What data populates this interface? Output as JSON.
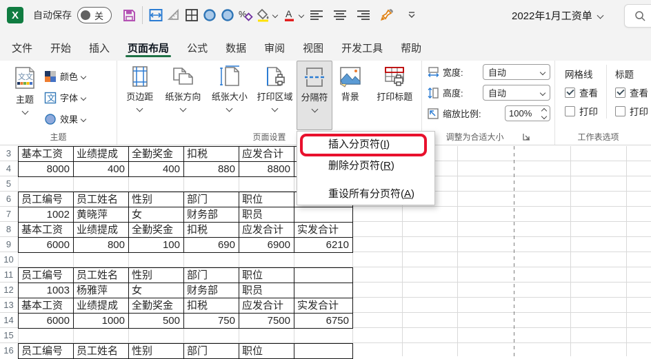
{
  "titlebar": {
    "autosave_label": "自动保存",
    "autosave_state": "关",
    "doc_title": "2022年1月工资单"
  },
  "tabs": {
    "items": [
      "文件",
      "开始",
      "插入",
      "页面布局",
      "公式",
      "数据",
      "审阅",
      "视图",
      "开发工具",
      "帮助"
    ],
    "active_index": 3
  },
  "ribbon": {
    "theme_group": {
      "label": "主题",
      "big_button": "主题",
      "items": [
        "颜色",
        "字体",
        "效果"
      ]
    },
    "page_setup_group": {
      "label": "页面设置",
      "buttons": [
        "页边距",
        "纸张方向",
        "纸张大小",
        "打印区域",
        "分隔符",
        "背景",
        "打印标题"
      ],
      "pressed_button": "分隔符"
    },
    "fit_group": {
      "label": "调整为合适大小",
      "width_label": "宽度:",
      "width_value": "自动",
      "height_label": "高度:",
      "height_value": "自动",
      "scale_label": "缩放比例:",
      "scale_value": "100%"
    },
    "sheet_options_group": {
      "label": "工作表选项",
      "columns": [
        {
          "title": "网格线",
          "view": {
            "label": "查看",
            "checked": true
          },
          "print": {
            "label": "打印",
            "checked": false
          }
        },
        {
          "title": "标题",
          "view": {
            "label": "查看",
            "checked": true
          },
          "print": {
            "label": "打印",
            "checked": false
          }
        }
      ]
    }
  },
  "menu": {
    "items": [
      {
        "pre": "插入分页符(",
        "key": "I",
        "suf": ")",
        "annotated": true
      },
      {
        "pre": "删除分页符(",
        "key": "R",
        "suf": ")"
      },
      {
        "sep": true
      },
      {
        "pre": "重设所有分页符(",
        "key": "A",
        "suf": ")"
      }
    ]
  },
  "annotation": {
    "color": "#e8112d",
    "target": "插入分页符(I)"
  },
  "accent_green": "#1e7145",
  "sheet": {
    "rows": [
      {
        "num": "3",
        "cells": [
          "基本工资",
          "业绩提成",
          "全勤奖金",
          "扣税",
          "应发合计",
          ""
        ]
      },
      {
        "num": "4",
        "cells": [
          "8000",
          "400",
          "400",
          "880",
          "8800",
          ""
        ]
      },
      {
        "num": "5",
        "cells": null
      },
      {
        "num": "6",
        "cells": [
          "员工编号",
          "员工姓名",
          "性别",
          "部门",
          "职位",
          ""
        ]
      },
      {
        "num": "7",
        "cells": [
          "1002",
          "黄晓萍",
          "女",
          "财务部",
          "职员",
          ""
        ]
      },
      {
        "num": "8",
        "cells": [
          "基本工资",
          "业绩提成",
          "全勤奖金",
          "扣税",
          "应发合计",
          "实发合计"
        ]
      },
      {
        "num": "9",
        "cells": [
          "6000",
          "800",
          "100",
          "690",
          "6900",
          "6210"
        ]
      },
      {
        "num": "10",
        "cells": null
      },
      {
        "num": "11",
        "cells": [
          "员工编号",
          "员工姓名",
          "性别",
          "部门",
          "职位",
          ""
        ]
      },
      {
        "num": "12",
        "cells": [
          "1003",
          "杨雅萍",
          "女",
          "财务部",
          "职员",
          ""
        ]
      },
      {
        "num": "13",
        "cells": [
          "基本工资",
          "业绩提成",
          "全勤奖金",
          "扣税",
          "应发合计",
          "实发合计"
        ]
      },
      {
        "num": "14",
        "cells": [
          "6000",
          "1000",
          "500",
          "750",
          "7500",
          "6750"
        ]
      },
      {
        "num": "15",
        "cells": null
      },
      {
        "num": "16",
        "cells": [
          "员工编号",
          "员工姓名",
          "性别",
          "部门",
          "职位",
          ""
        ]
      }
    ]
  }
}
